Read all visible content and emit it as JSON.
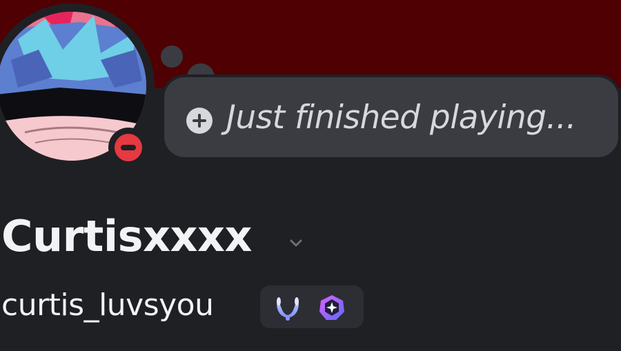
{
  "profile": {
    "display_name": "Curtisxxxx",
    "username": "curtis_luvsyou",
    "status": "do-not-disturb",
    "custom_status_placeholder": "Just finished playing...",
    "badges": [
      "laurel-wreath-badge-icon",
      "nitro-gem-badge-icon"
    ]
  },
  "colors": {
    "banner": "#4f0002",
    "background": "#1f2024",
    "bubble": "#3a3c42",
    "text": "#f2f3f5",
    "status_dnd": "#e63940"
  }
}
